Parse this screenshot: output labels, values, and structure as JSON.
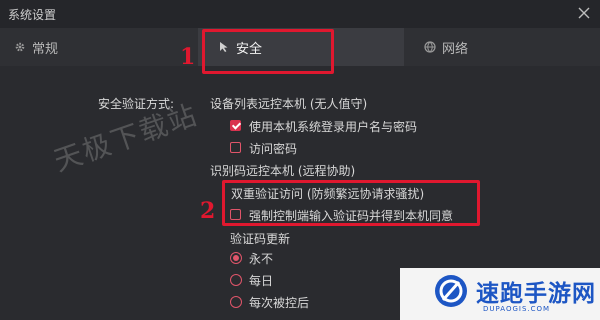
{
  "window": {
    "title": "系统设置"
  },
  "tabs": [
    {
      "label": "常规",
      "icon": "gear-icon"
    },
    {
      "label": "安全",
      "icon": "cursor-icon",
      "active": true
    },
    {
      "label": "网络",
      "icon": "globe-icon"
    }
  ],
  "annotations": {
    "marker1": "1",
    "marker2": "2"
  },
  "security": {
    "verify_mode_label": "安全验证方式:",
    "device_list_heading": "设备列表远控本机 (无人值守)",
    "use_system_login": {
      "label": "使用本机系统登录用户名与密码",
      "checked": true
    },
    "access_password": {
      "label": "访问密码",
      "checked": false
    },
    "code_heading": "识别码远控本机 (远程协助)",
    "dual_verify_note": "双重验证访问 (防频繁远协请求骚扰)",
    "force_controller_code": {
      "label": "强制控制端输入验证码并得到本机同意",
      "checked": false
    },
    "code_update_label": "验证码更新",
    "code_update_options": [
      {
        "label": "永不",
        "selected": true
      },
      {
        "label": "每日",
        "selected": false
      },
      {
        "label": "每次被控后",
        "selected": false
      }
    ]
  },
  "watermark": "天极下载站",
  "brand": {
    "name": "速跑手游网",
    "url": "DUPAOGIS.COM"
  },
  "colors": {
    "accent": "#e0556a",
    "annotation_red": "#e0182f",
    "brand_blue": "#1d56c4",
    "background": "#2a2b2f"
  }
}
